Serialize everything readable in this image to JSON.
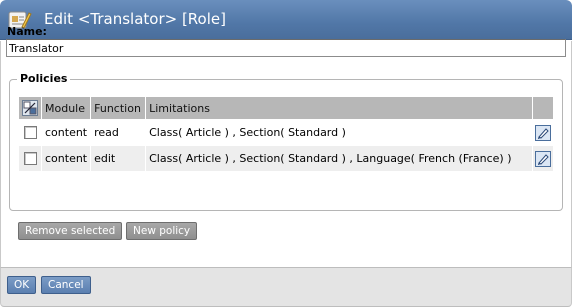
{
  "window": {
    "title": "Edit <Translator> [Role]"
  },
  "form": {
    "name_label": "Name:",
    "name_value": "Translator"
  },
  "policies": {
    "legend": "Policies",
    "columns": [
      "Module",
      "Function",
      "Limitations"
    ],
    "rows": [
      {
        "module": "content",
        "function": "read",
        "limitations": "Class( Article ) , Section( Standard )"
      },
      {
        "module": "content",
        "function": "edit",
        "limitations": "Class( Article ) , Section( Standard ) , Language( French (France) )"
      }
    ],
    "remove_selected_label": "Remove selected",
    "new_policy_label": "New policy"
  },
  "footer": {
    "ok_label": "OK",
    "cancel_label": "Cancel"
  },
  "icons": {
    "title": "edit-role-icon",
    "toggle": "invert-selection-icon",
    "edit": "pencil-icon"
  },
  "colors": {
    "titlebar": "#5177a7",
    "header_cell": "#b7b7b7",
    "button_gray": "#999999",
    "button_blue": "#6a8dbb"
  }
}
